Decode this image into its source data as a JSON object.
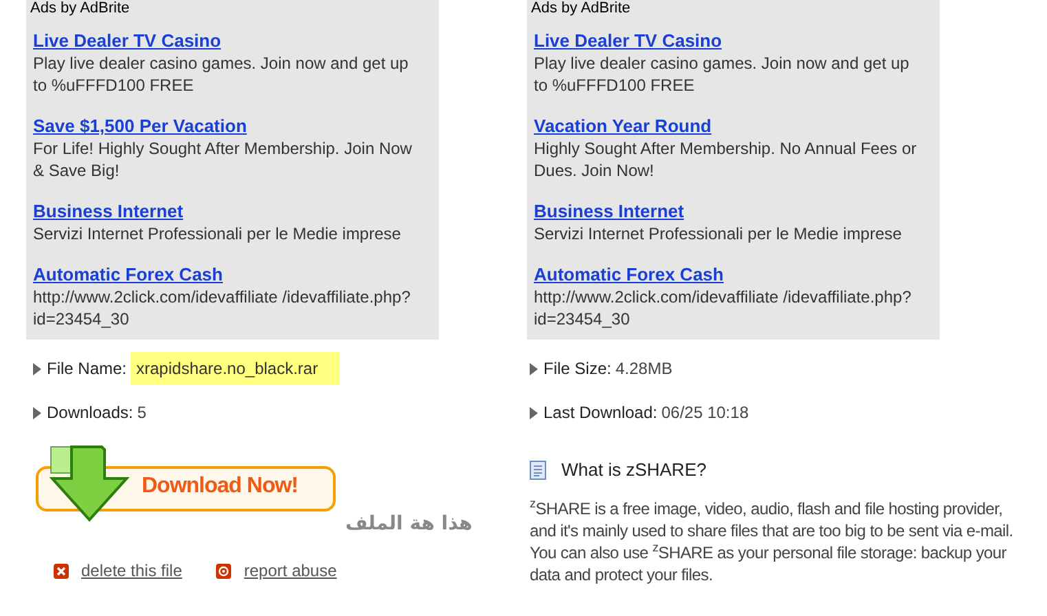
{
  "ad_panels": [
    {
      "header": "Ads by AdBrite",
      "ads": [
        {
          "title": "Live Dealer TV Casino",
          "text": "Play live dealer casino games. Join now and get up to %uFFFD100 FREE"
        },
        {
          "title": "Save $1,500 Per Vacation",
          "text": "For Life! Highly Sought After Membership. Join Now & Save Big!"
        },
        {
          "title": "Business Internet",
          "text": "Servizi Internet Professionali per le Medie imprese"
        },
        {
          "title": "Automatic Forex Cash",
          "text": "http://www.2click.com/idevaffiliate /idevaffiliate.php?id=23454_30"
        }
      ]
    },
    {
      "header": "Ads by AdBrite",
      "ads": [
        {
          "title": "Live Dealer TV Casino",
          "text": "Play live dealer casino games. Join now and get up to %uFFFD100 FREE"
        },
        {
          "title": "Vacation Year Round",
          "text": "Highly Sought After Membership. No Annual Fees or Dues. Join Now!"
        },
        {
          "title": "Business Internet",
          "text": "Servizi Internet Professionali per le Medie imprese"
        },
        {
          "title": "Automatic Forex Cash",
          "text": "http://www.2click.com/idevaffiliate /idevaffiliate.php?id=23454_30"
        }
      ]
    }
  ],
  "file_info": [
    [
      {
        "label": "File Name:",
        "value": "xrapidshare.no_black.rar",
        "highlighted": true
      },
      {
        "label": "Downloads:",
        "value": "5",
        "highlighted": false
      }
    ],
    [
      {
        "label": "File Size:",
        "value": "4.28MB",
        "highlighted": false
      },
      {
        "label": "Last Download:",
        "value": "06/25 10:18",
        "highlighted": false
      }
    ]
  ],
  "download_button": {
    "label": "Download Now!"
  },
  "overlay_text": "هذا هة الملف",
  "actions": [
    {
      "kind": "delete",
      "label": "delete this file"
    },
    {
      "kind": "report",
      "label": "report abuse"
    }
  ],
  "about": {
    "title": "What is zSHARE?",
    "text": "$^{z}$SHARE is a free image, video, audio, flash and file hosting provider, and it's mainly used to share files that are too big to be sent via e-mail. You can also use $^{z}$SHARE as your personal file storage: backup your data and protect your files."
  }
}
